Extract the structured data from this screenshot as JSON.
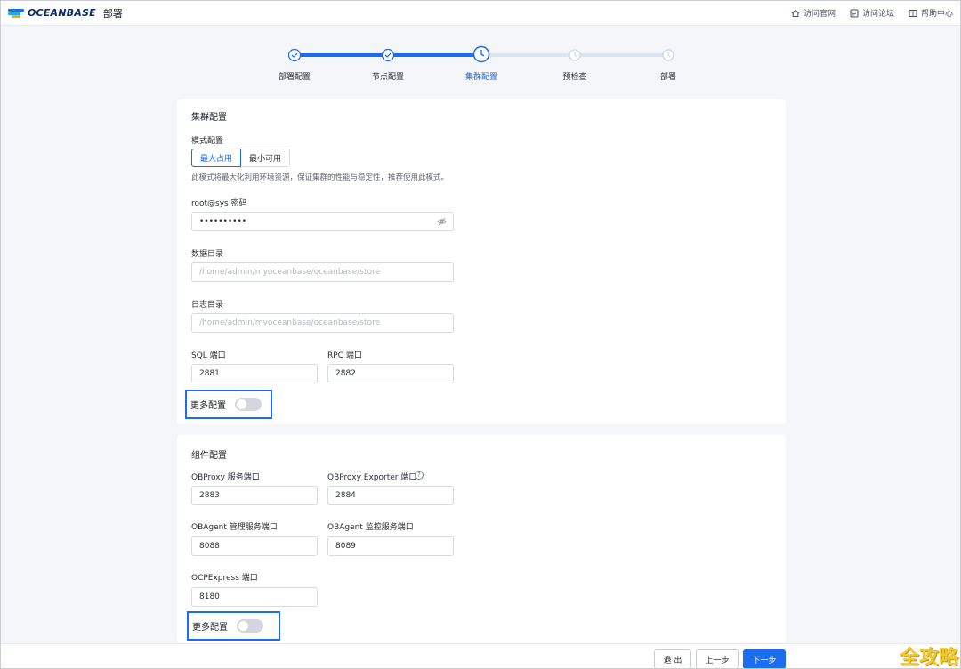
{
  "header": {
    "brand": "OCEANBASE",
    "brand_sub": "部署",
    "links": [
      {
        "label": "访问官网",
        "icon": "home-icon"
      },
      {
        "label": "访问论坛",
        "icon": "forum-icon"
      },
      {
        "label": "帮助中心",
        "icon": "book-icon"
      }
    ]
  },
  "steps": {
    "items": [
      {
        "label": "部署配置",
        "status": "done"
      },
      {
        "label": "节点配置",
        "status": "done"
      },
      {
        "label": "集群配置",
        "status": "current"
      },
      {
        "label": "预检查",
        "status": "pending"
      },
      {
        "label": "部署",
        "status": "pending"
      }
    ],
    "colors": {
      "active": "#1a6cf0",
      "inactive": "#dbe3ef"
    }
  },
  "cluster": {
    "title": "集群配置",
    "mode_label": "模式配置",
    "mode_options": [
      "最大占用",
      "最小可用"
    ],
    "mode_selected": "最大占用",
    "mode_hint": "此模式将最大化利用环境资源，保证集群的性能与稳定性，推荐使用此模式。",
    "password_label": "root@sys 密码",
    "password_value": "••••••••••",
    "data_dir_label": "数据目录",
    "data_dir_placeholder": "/home/admin/myoceanbase/oceanbase/store",
    "log_dir_label": "日志目录",
    "log_dir_placeholder": "/home/admin/myoceanbase/oceanbase/store",
    "sql_port_label": "SQL 端口",
    "sql_port_value": "2881",
    "rpc_port_label": "RPC 端口",
    "rpc_port_value": "2882",
    "more_label": "更多配置",
    "more_enabled": false
  },
  "components": {
    "title": "组件配置",
    "obproxy_port_label": "OBProxy 服务端口",
    "obproxy_port_value": "2883",
    "obproxy_exporter_label": "OBProxy Exporter 端口",
    "obproxy_exporter_value": "2884",
    "obagent_mgr_label": "OBAgent 管理服务端口",
    "obagent_mgr_value": "8088",
    "obagent_mon_label": "OBAgent 监控服务端口",
    "obagent_mon_value": "8089",
    "ocp_label": "OCPExpress 端口",
    "ocp_value": "8180",
    "more_label": "更多配置",
    "more_enabled": false
  },
  "footer": {
    "exit": "退 出",
    "prev": "上一步",
    "next": "下一步"
  },
  "watermark": "全攻略"
}
